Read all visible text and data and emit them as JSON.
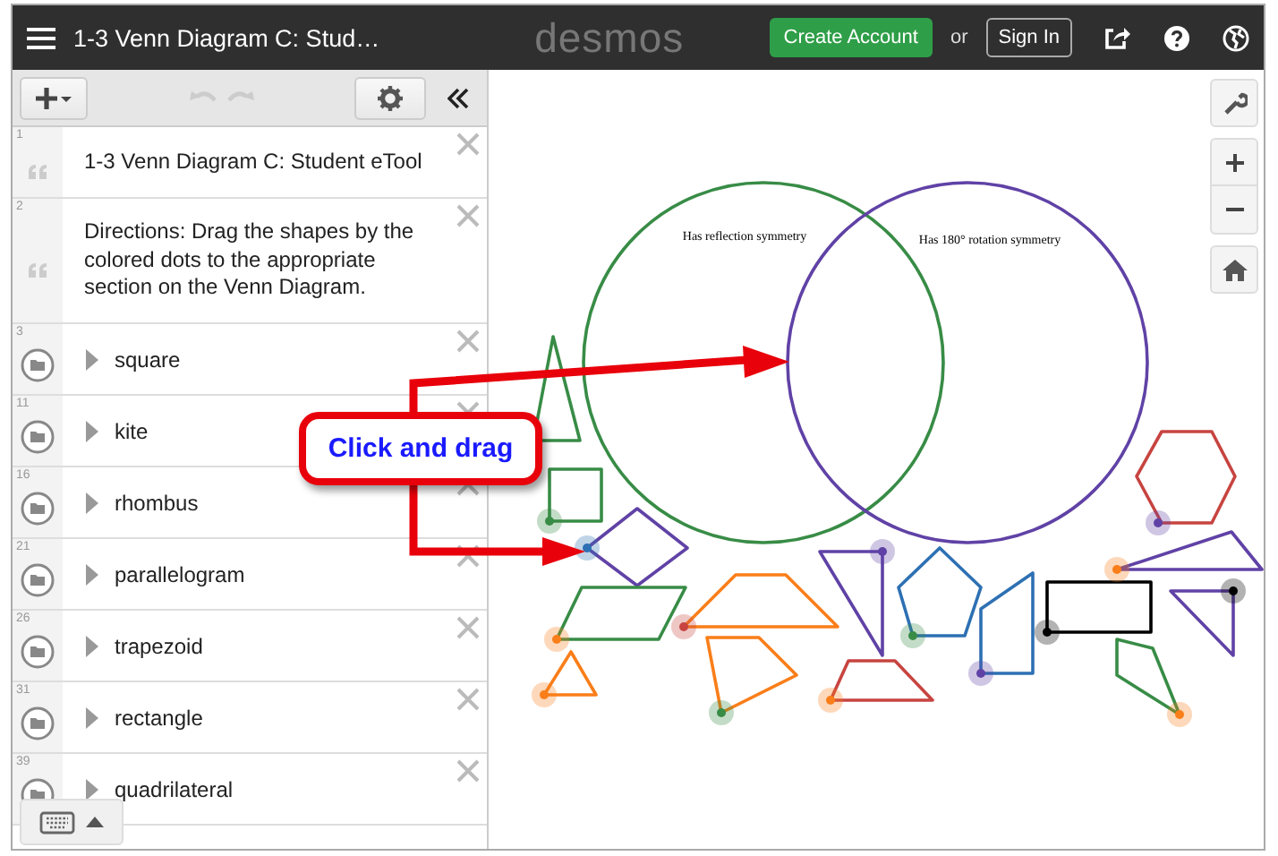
{
  "header": {
    "title": "1-3 Venn Diagram C: Stud…",
    "logo": "desmos",
    "create_account": "Create Account",
    "or": "or",
    "sign_in": "Sign In"
  },
  "sidebar": {
    "rows": [
      {
        "number": "1",
        "kind": "note",
        "text": "1-3 Venn Diagram C: Student eTool"
      },
      {
        "number": "2",
        "kind": "note",
        "text": "Directions: Drag the shapes by the colored dots to the appropriate section on the Venn Diagram."
      },
      {
        "number": "3",
        "kind": "folder",
        "text": "square",
        "expanded": false
      },
      {
        "number": "11",
        "kind": "folder",
        "text": "kite",
        "expanded": false
      },
      {
        "number": "16",
        "kind": "folder",
        "text": "rhombus",
        "expanded": false
      },
      {
        "number": "21",
        "kind": "folder",
        "text": "parallelogram",
        "expanded": false
      },
      {
        "number": "26",
        "kind": "folder",
        "text": "trapezoid",
        "expanded": false
      },
      {
        "number": "31",
        "kind": "folder",
        "text": "rectangle",
        "expanded": false
      },
      {
        "number": "39",
        "kind": "folder",
        "text": "quadrilateral",
        "expanded": false
      }
    ]
  },
  "canvas": {
    "labels": [
      "Has reflection symmetry",
      "Has 180° rotation symmetry"
    ]
  },
  "callout": {
    "text": "Click and drag"
  }
}
